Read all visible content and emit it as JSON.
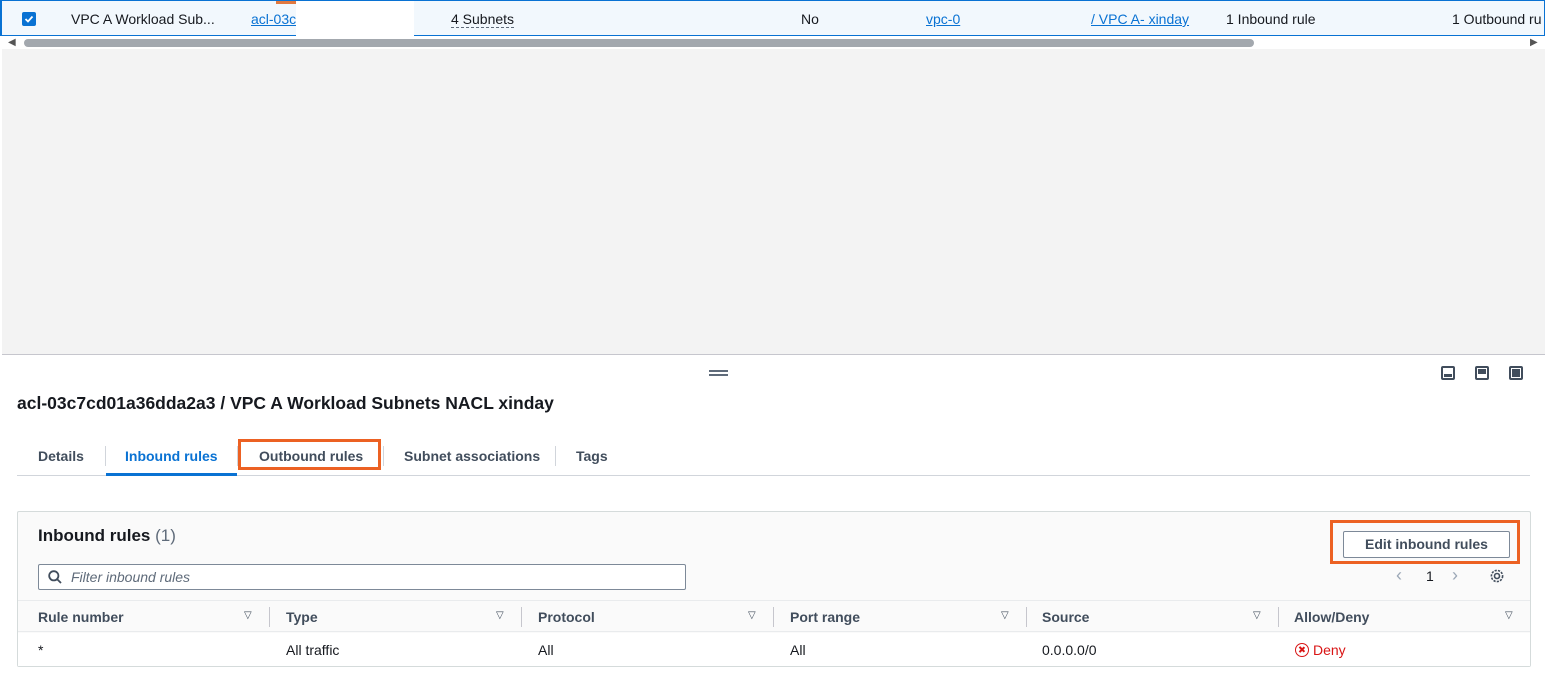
{
  "list_row": {
    "name": "VPC A Workload Sub...",
    "acl_id": "acl-03c",
    "associated_with": "4 Subnets",
    "default": "No",
    "vpc_id": "vpc-0",
    "vpc_name": " / VPC A- xinday",
    "inbound_rules": "1 Inbound rule",
    "outbound_rules": "1 Outbound ru",
    "selected": true
  },
  "details": {
    "title": "acl-03c7cd01a36dda2a3 / VPC A Workload Subnets NACL xinday"
  },
  "tabs": [
    {
      "label": "Details",
      "active": false
    },
    {
      "label": "Inbound rules",
      "active": true
    },
    {
      "label": "Outbound rules",
      "active": false,
      "highlighted": true
    },
    {
      "label": "Subnet associations",
      "active": false
    },
    {
      "label": "Tags",
      "active": false
    }
  ],
  "inbound": {
    "title": "Inbound rules",
    "count": "(1)",
    "edit_button": "Edit inbound rules",
    "filter_placeholder": "Filter inbound rules",
    "page": "1",
    "columns": [
      "Rule number",
      "Type",
      "Protocol",
      "Port range",
      "Source",
      "Allow/Deny"
    ],
    "rows": [
      {
        "rule_number": "*",
        "type": "All traffic",
        "protocol": "All",
        "port_range": "All",
        "source": "0.0.0.0/0",
        "action": "Deny"
      }
    ]
  },
  "colors": {
    "accent": "#0972d3",
    "highlight": "#ec6123",
    "deny": "#d91515"
  }
}
